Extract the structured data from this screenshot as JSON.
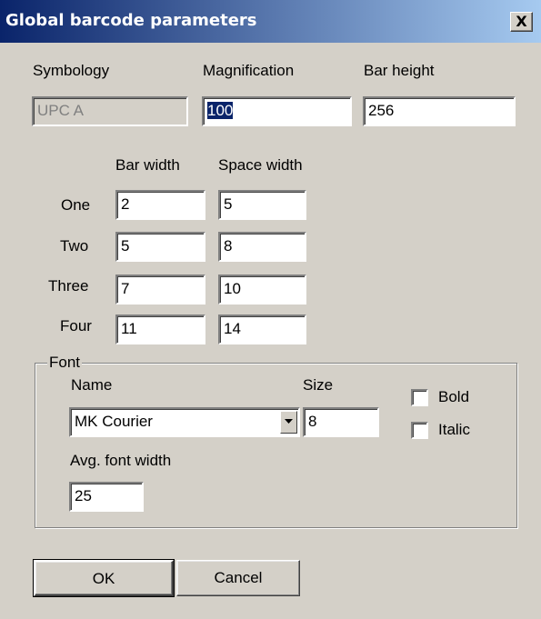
{
  "window": {
    "title": "Global barcode parameters",
    "close_glyph": "X"
  },
  "top": {
    "symbology_label": "Symbology",
    "symbology_value": "UPC A",
    "magnification_label": "Magnification",
    "magnification_value": "100",
    "bar_height_label": "Bar height",
    "bar_height_value": "256"
  },
  "widths": {
    "bar_width_header": "Bar width",
    "space_width_header": "Space width",
    "rows": [
      {
        "label": "One",
        "bar": "2",
        "space": "5"
      },
      {
        "label": "Two",
        "bar": "5",
        "space": "8"
      },
      {
        "label": "Three",
        "bar": "7",
        "space": "10"
      },
      {
        "label": "Four",
        "bar": "11",
        "space": "14"
      }
    ]
  },
  "font": {
    "group_label": "Font",
    "name_label": "Name",
    "name_value": "MK Courier",
    "size_label": "Size",
    "size_value": "8",
    "bold_label": "Bold",
    "bold_checked": false,
    "italic_label": "Italic",
    "italic_checked": false,
    "avg_label": "Avg. font width",
    "avg_value": "25"
  },
  "buttons": {
    "ok_label": "OK",
    "cancel_label": "Cancel"
  },
  "colors": {
    "title_bar_start": "#0a246a",
    "title_bar_end": "#a6caf0",
    "dialog_background": "#d4d0c8",
    "selection": "#0a246a"
  }
}
